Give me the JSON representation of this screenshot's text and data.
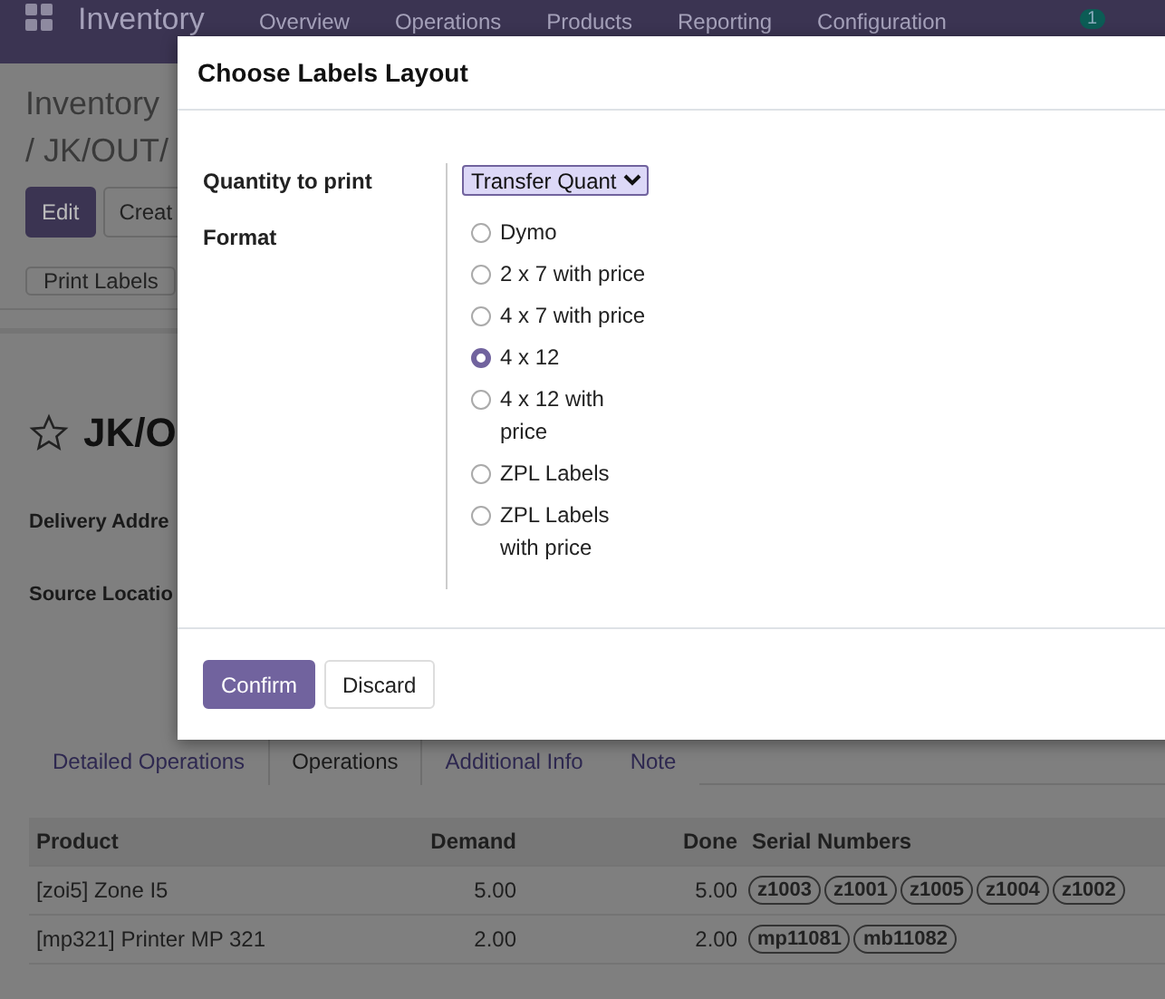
{
  "navbar": {
    "app": "Inventory",
    "menus": [
      "Overview",
      "Operations",
      "Products",
      "Reporting",
      "Configuration"
    ],
    "badge": "1"
  },
  "breadcrumb": {
    "title": "Inventory",
    "record": "/ JK/OUT/"
  },
  "actions": [
    {
      "label": "Edit",
      "kind": "primary"
    },
    {
      "label": "Creat",
      "kind": "secondary"
    }
  ],
  "status_buttons": [
    "Print Labels"
  ],
  "record": {
    "name": "JK/O",
    "starred": false,
    "fields": [
      "Delivery Addre",
      "Source Locatio"
    ]
  },
  "dialog": {
    "title": "Choose Labels Layout",
    "quantity_label": "Quantity to print",
    "quantity_value": "Transfer Quant",
    "format_label": "Format",
    "formats": [
      {
        "label": "Dymo",
        "selected": false
      },
      {
        "label": "2 x 7 with price",
        "selected": false
      },
      {
        "label": "4 x 7 with price",
        "selected": false
      },
      {
        "label": "4 x 12",
        "selected": true
      },
      {
        "label": "4 x 12 with price",
        "selected": false
      },
      {
        "label": "ZPL Labels",
        "selected": false
      },
      {
        "label": "ZPL Labels with price",
        "selected": false
      }
    ],
    "buttons": [
      {
        "label": "Confirm",
        "kind": "primary"
      },
      {
        "label": "Discard",
        "kind": "secondary"
      }
    ]
  },
  "tabs": [
    {
      "label": "Detailed Operations",
      "selected": false
    },
    {
      "label": "Operations",
      "selected": true
    },
    {
      "label": "Additional Info",
      "selected": false
    },
    {
      "label": "Note",
      "selected": false
    }
  ],
  "table": {
    "columns": [
      "Product",
      "Demand",
      "Done",
      "Serial Numbers"
    ],
    "rows": [
      {
        "product": "[zoi5] Zone I5",
        "demand": "5.00",
        "done": "5.00",
        "serials": [
          "z1003",
          "z1001",
          "z1005",
          "z1004",
          "z1002"
        ]
      },
      {
        "product": "[mp321] Printer MP 321",
        "demand": "2.00",
        "done": "2.00",
        "serials": [
          "mp11081",
          "mb11082"
        ]
      }
    ]
  }
}
